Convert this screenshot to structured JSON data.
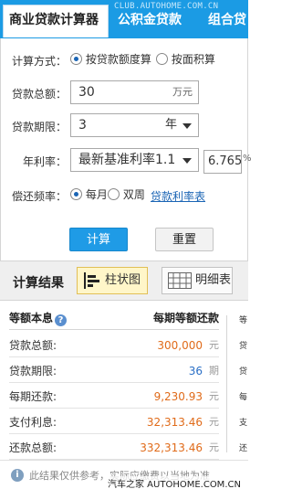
{
  "tabs": [
    {
      "label": "商业贷款计算器",
      "active": true
    },
    {
      "label": "公积金贷款",
      "active": false
    },
    {
      "label": "组合贷",
      "active": false
    }
  ],
  "url_watermark": "CLUB.AUTOHOME.COM.CN",
  "form": {
    "method": {
      "label": "计算方式：",
      "options": [
        "按贷款额度算",
        "按面积算"
      ],
      "selected": "按贷款额度算"
    },
    "amount": {
      "label": "贷款总额：",
      "value": "30",
      "unit": "万元"
    },
    "term": {
      "label": "贷款期限：",
      "value": "3",
      "unit": "年"
    },
    "rate": {
      "label": "年利率：",
      "select": "最新基准利率1.1",
      "value": "6.765",
      "unit": "%"
    },
    "frequency": {
      "label": "偿还频率：",
      "options": [
        "每月",
        "双周"
      ],
      "selected": "每月",
      "link": "贷款利率表"
    },
    "calc_button": "计算",
    "reset_button": "重置"
  },
  "results": {
    "title": "计算结果",
    "views": [
      {
        "label": "柱状图",
        "active": true
      },
      {
        "label": "明细表",
        "active": false
      }
    ],
    "header": {
      "col1": "等额本息",
      "hint": "?",
      "col2": "每期等额还款"
    },
    "rows": [
      {
        "key": "贷款总额:",
        "value": "300,000",
        "unit": "元",
        "color": "#e06b1a"
      },
      {
        "key": "贷款期限:",
        "value": "36",
        "unit": "期",
        "color": "#2a6fc6"
      },
      {
        "key": "每期还款:",
        "value": "9,230.93",
        "unit": "元",
        "color": "#e06b1a"
      },
      {
        "key": "支付利息:",
        "value": "32,313.46",
        "unit": "元",
        "color": "#e06b1a"
      },
      {
        "key": "还款总额:",
        "value": "332,313.46",
        "unit": "元",
        "color": "#e06b1a"
      }
    ],
    "right_col_glyphs": [
      "等",
      "贷",
      "贷",
      "每",
      "支",
      "还"
    ]
  },
  "footer": {
    "note": "此结果仅供参考，实际应缴费以当地为准",
    "watermark": "汽车之家  AUTOHOME.COM.CN"
  },
  "colors": {
    "brand": "#1b9be4",
    "value_orange": "#e06b1a",
    "value_blue": "#2a6fc6",
    "link": "#1b65b5"
  }
}
